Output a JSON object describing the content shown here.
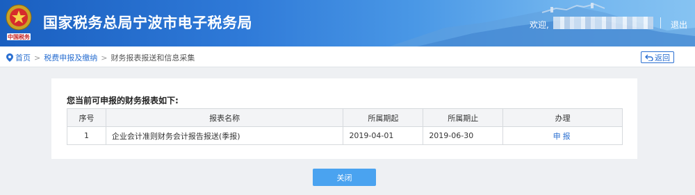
{
  "header": {
    "title": "国家税务总局宁波市电子税务局",
    "welcome": "欢迎,",
    "logout": "退出",
    "emblem_text": "中国税务"
  },
  "breadcrumb": {
    "home": "首页",
    "level1": "税费申报及缴纳",
    "current": "财务报表报送和信息采集",
    "separator": ">"
  },
  "back_button": {
    "label": "返回"
  },
  "panel": {
    "title": "您当前可申报的财务报表如下:",
    "columns": [
      "序号",
      "报表名称",
      "所属期起",
      "所属期止",
      "办理"
    ],
    "rows": [
      {
        "index": "1",
        "name": "企业会计准则财务会计报告报送(季报)",
        "period_start": "2019-04-01",
        "period_end": "2019-06-30",
        "action": "申报"
      }
    ]
  },
  "close_button": {
    "label": "关闭"
  },
  "colors": {
    "header_blue": "#1a5fc0",
    "link_blue": "#2a6fd1",
    "close_button": "#4aa3f0"
  },
  "icons": {
    "location": "location-pin-icon",
    "back": "return-arrow-icon",
    "emblem": "tax-emblem-icon"
  }
}
